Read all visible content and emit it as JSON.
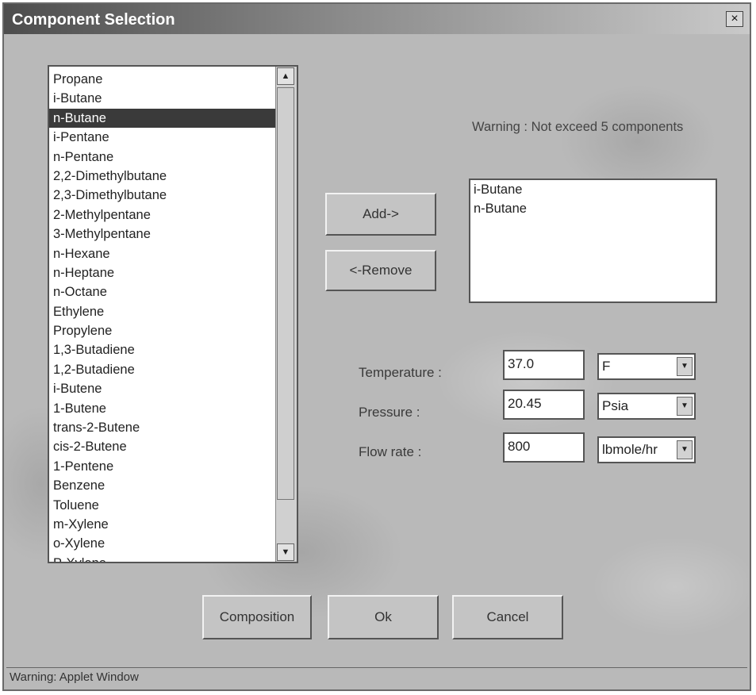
{
  "window": {
    "title": "Component Selection",
    "close_glyph": "×"
  },
  "available_components": {
    "selected_index": 2,
    "items": [
      "Propane",
      "i-Butane",
      "n-Butane",
      "i-Pentane",
      "n-Pentane",
      "2,2-Dimethylbutane",
      "2,3-Dimethylbutane",
      "2-Methylpentane",
      "3-Methylpentane",
      "n-Hexane",
      "n-Heptane",
      "n-Octane",
      "Ethylene",
      "Propylene",
      "1,3-Butadiene",
      "1,2-Butadiene",
      "i-Butene",
      "1-Butene",
      "trans-2-Butene",
      "cis-2-Butene",
      "1-Pentene",
      "Benzene",
      "Toluene",
      "m-Xylene",
      "o-Xylene",
      "P-Xylene"
    ]
  },
  "warning": "Warning : Not exceed 5 components",
  "buttons": {
    "add": "Add->",
    "remove": "<-Remove",
    "composition": "Composition",
    "ok": "Ok",
    "cancel": "Cancel"
  },
  "selected_components": [
    "i-Butane",
    "n-Butane"
  ],
  "params": {
    "temperature": {
      "label": "Temperature :",
      "value": "37.0",
      "unit": "F"
    },
    "pressure": {
      "label": "Pressure :",
      "value": "20.45",
      "unit": "Psia"
    },
    "flow_rate": {
      "label": "Flow rate :",
      "value": "800",
      "unit": "lbmole/hr"
    }
  },
  "icons": {
    "scroll_up": "▲",
    "scroll_down": "▼",
    "dropdown": "▼"
  },
  "status_bar": "Warning: Applet Window"
}
